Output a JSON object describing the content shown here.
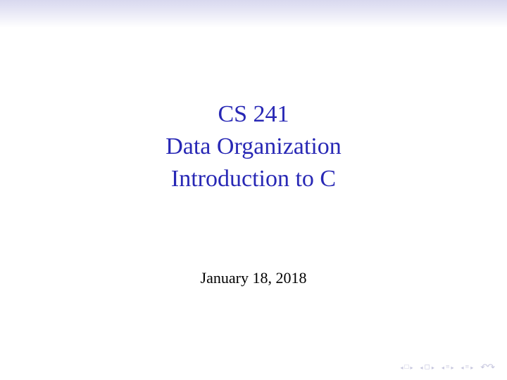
{
  "title": {
    "line1": "CS 241",
    "line2": "Data Organization",
    "line3": "Introduction to C"
  },
  "date": "January 18, 2018",
  "nav": {
    "square": "□",
    "frame": "◻",
    "equiv1": "≡",
    "equiv2": "≡",
    "arrow_left": "◂",
    "arrow_right": "▸",
    "undo_redo": "↶↷"
  }
}
